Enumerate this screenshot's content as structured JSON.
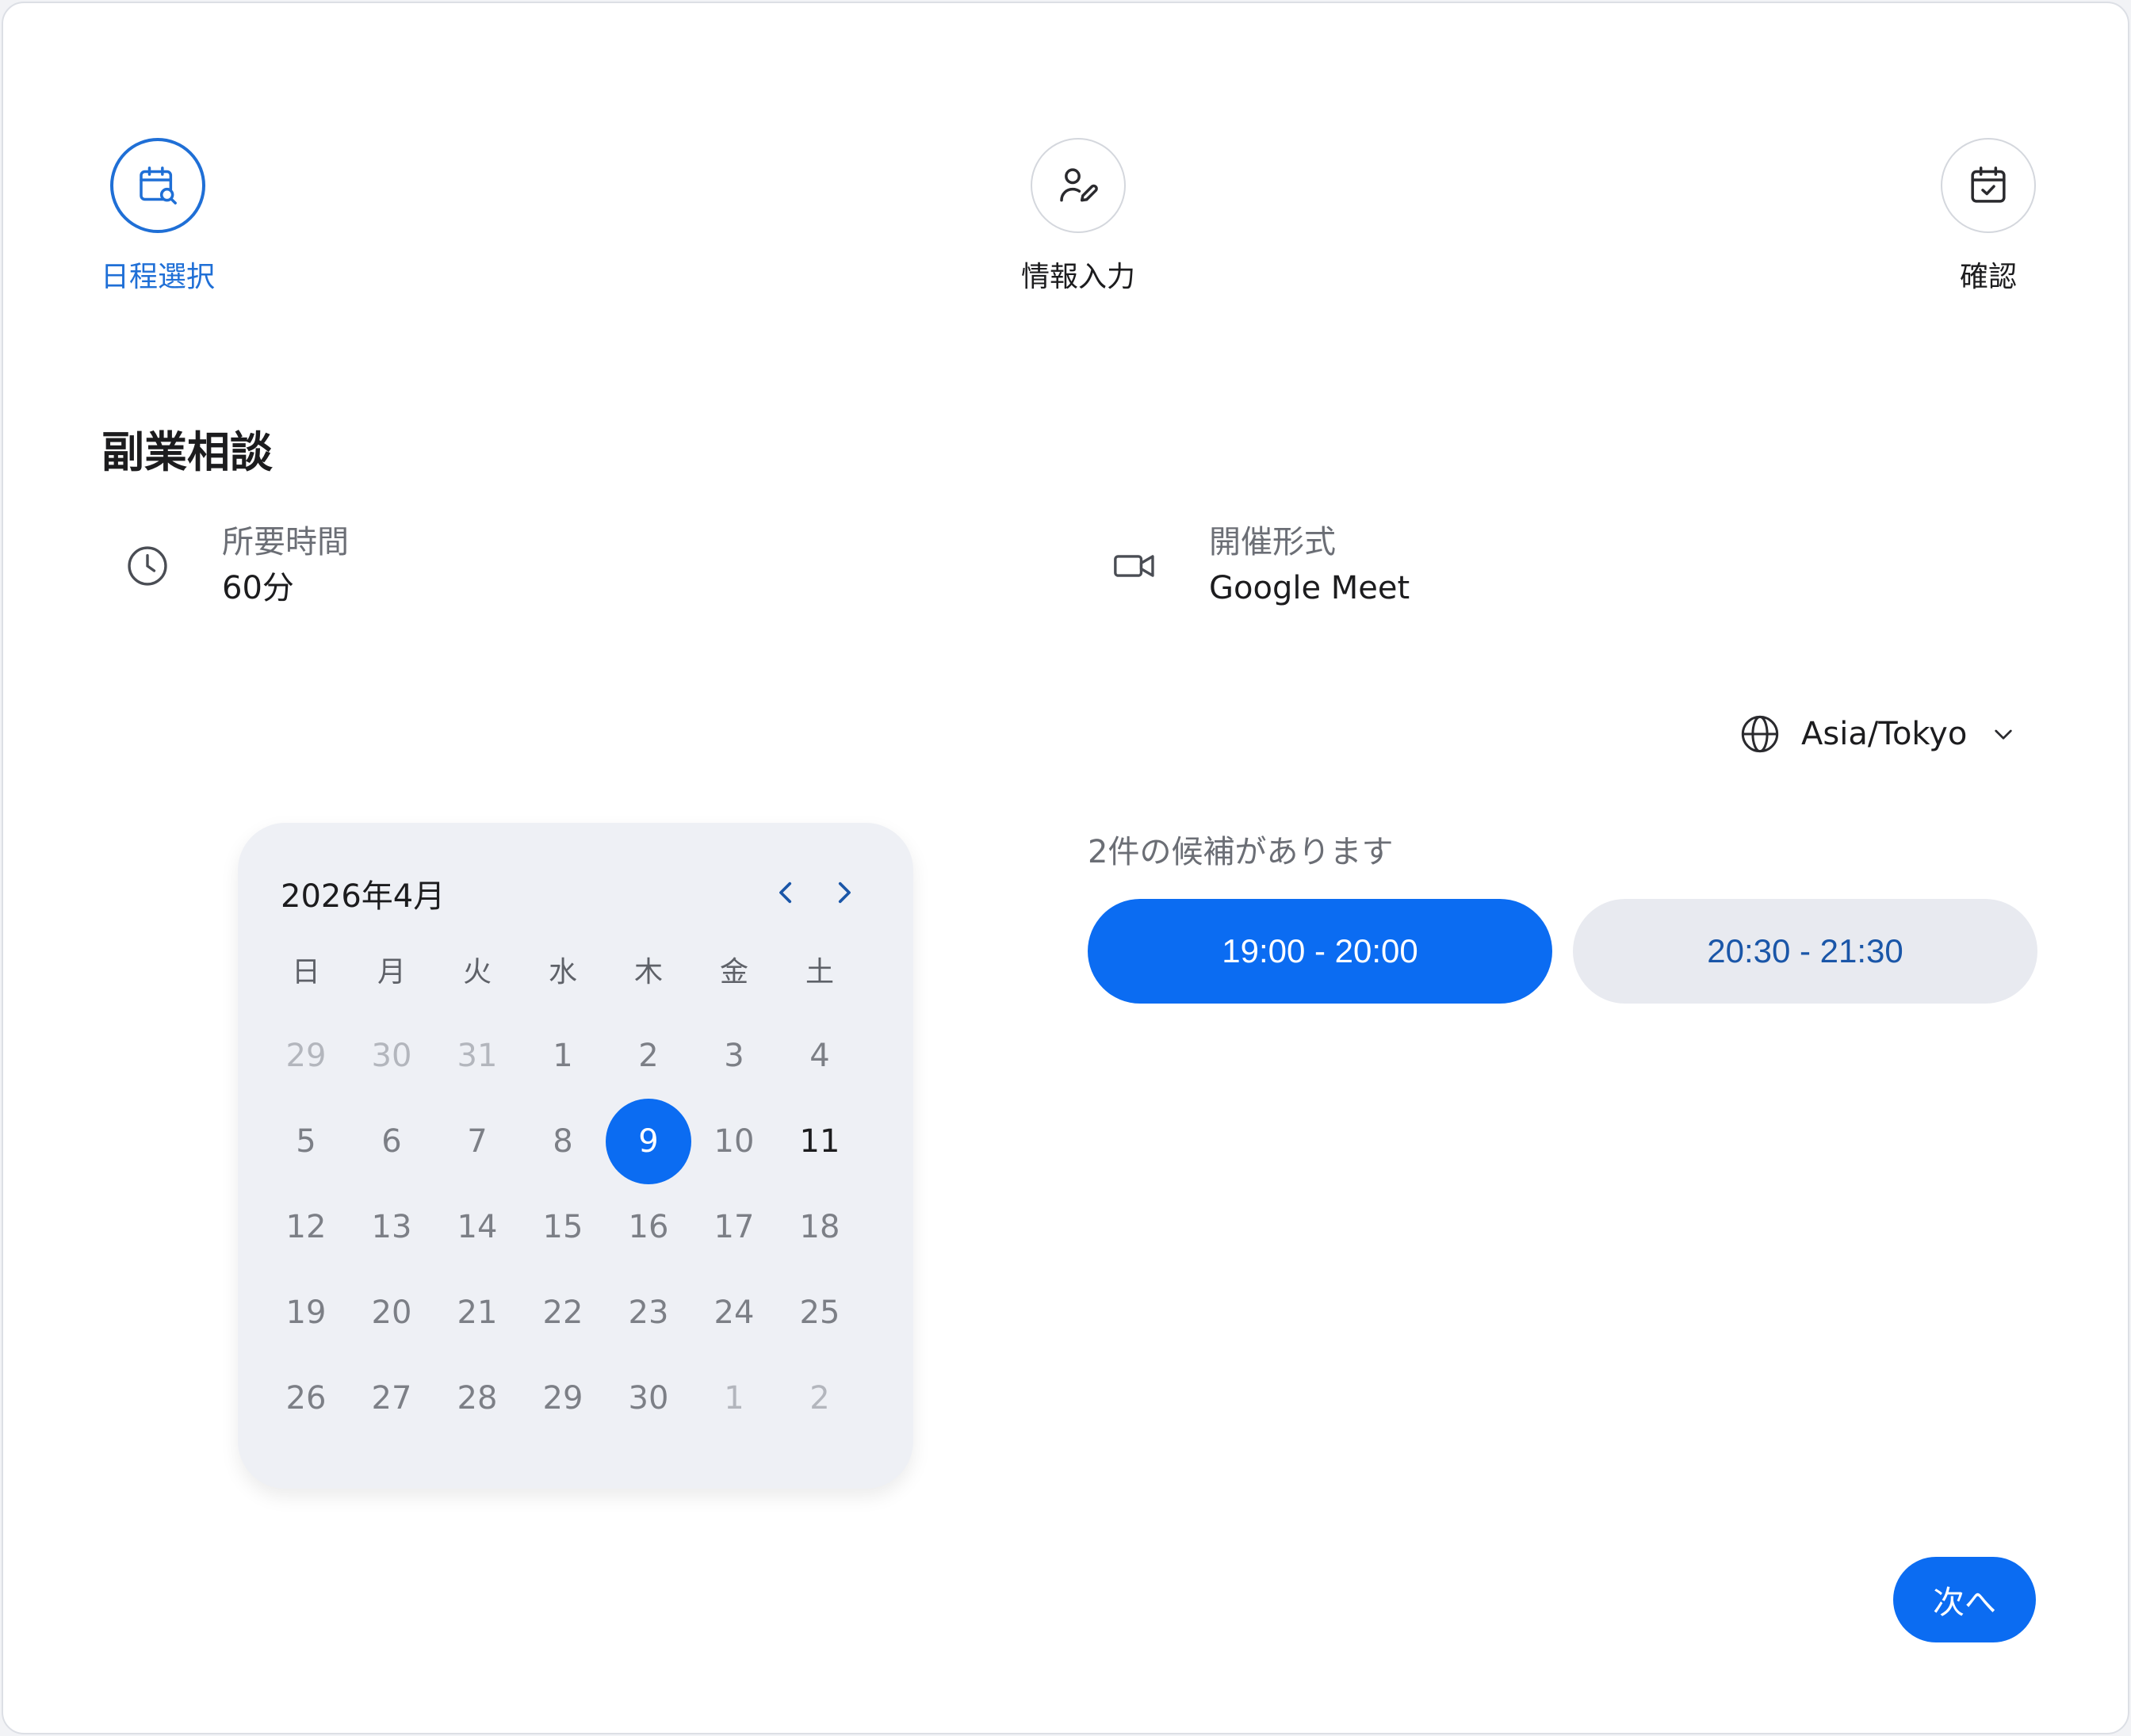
{
  "stepper": {
    "steps": [
      {
        "label": "日程選択",
        "icon": "calendar-search-icon",
        "active": true
      },
      {
        "label": "情報入力",
        "icon": "user-edit-icon",
        "active": false
      },
      {
        "label": "確認",
        "icon": "calendar-check-icon",
        "active": false
      }
    ]
  },
  "event": {
    "title": "副業相談",
    "duration": {
      "label": "所要時間",
      "value": "60分",
      "icon": "clock-icon"
    },
    "format": {
      "label": "開催形式",
      "value": "Google Meet",
      "icon": "video-camera-icon"
    }
  },
  "timezone": {
    "value": "Asia/Tokyo",
    "icon": "globe-icon"
  },
  "calendar": {
    "month_label": "2026年4月",
    "weekdays": [
      "日",
      "月",
      "火",
      "水",
      "木",
      "金",
      "土"
    ],
    "weeks": [
      [
        {
          "d": "29",
          "s": "muted"
        },
        {
          "d": "30",
          "s": "muted"
        },
        {
          "d": "31",
          "s": "muted"
        },
        {
          "d": "1",
          "s": ""
        },
        {
          "d": "2",
          "s": ""
        },
        {
          "d": "3",
          "s": ""
        },
        {
          "d": "4",
          "s": ""
        }
      ],
      [
        {
          "d": "5",
          "s": ""
        },
        {
          "d": "6",
          "s": ""
        },
        {
          "d": "7",
          "s": ""
        },
        {
          "d": "8",
          "s": ""
        },
        {
          "d": "9",
          "s": "selected"
        },
        {
          "d": "10",
          "s": ""
        },
        {
          "d": "11",
          "s": "dark"
        }
      ],
      [
        {
          "d": "12",
          "s": ""
        },
        {
          "d": "13",
          "s": ""
        },
        {
          "d": "14",
          "s": ""
        },
        {
          "d": "15",
          "s": ""
        },
        {
          "d": "16",
          "s": ""
        },
        {
          "d": "17",
          "s": ""
        },
        {
          "d": "18",
          "s": ""
        }
      ],
      [
        {
          "d": "19",
          "s": ""
        },
        {
          "d": "20",
          "s": ""
        },
        {
          "d": "21",
          "s": ""
        },
        {
          "d": "22",
          "s": ""
        },
        {
          "d": "23",
          "s": ""
        },
        {
          "d": "24",
          "s": ""
        },
        {
          "d": "25",
          "s": ""
        }
      ],
      [
        {
          "d": "26",
          "s": ""
        },
        {
          "d": "27",
          "s": ""
        },
        {
          "d": "28",
          "s": ""
        },
        {
          "d": "29",
          "s": ""
        },
        {
          "d": "30",
          "s": ""
        },
        {
          "d": "1",
          "s": "muted"
        },
        {
          "d": "2",
          "s": "muted"
        }
      ]
    ],
    "colors": {
      "selected": "#0b6cf2",
      "background": "#eef0f5"
    }
  },
  "slots": {
    "count_label": "2件の候補があります",
    "items": [
      {
        "label": "19:00 - 20:00",
        "selected": true
      },
      {
        "label": "20:30 - 21:30",
        "selected": false
      }
    ]
  },
  "actions": {
    "next_label": "次へ"
  },
  "theme": {
    "accent": "#0b6cf2",
    "step_active": "#1f6fd6"
  }
}
